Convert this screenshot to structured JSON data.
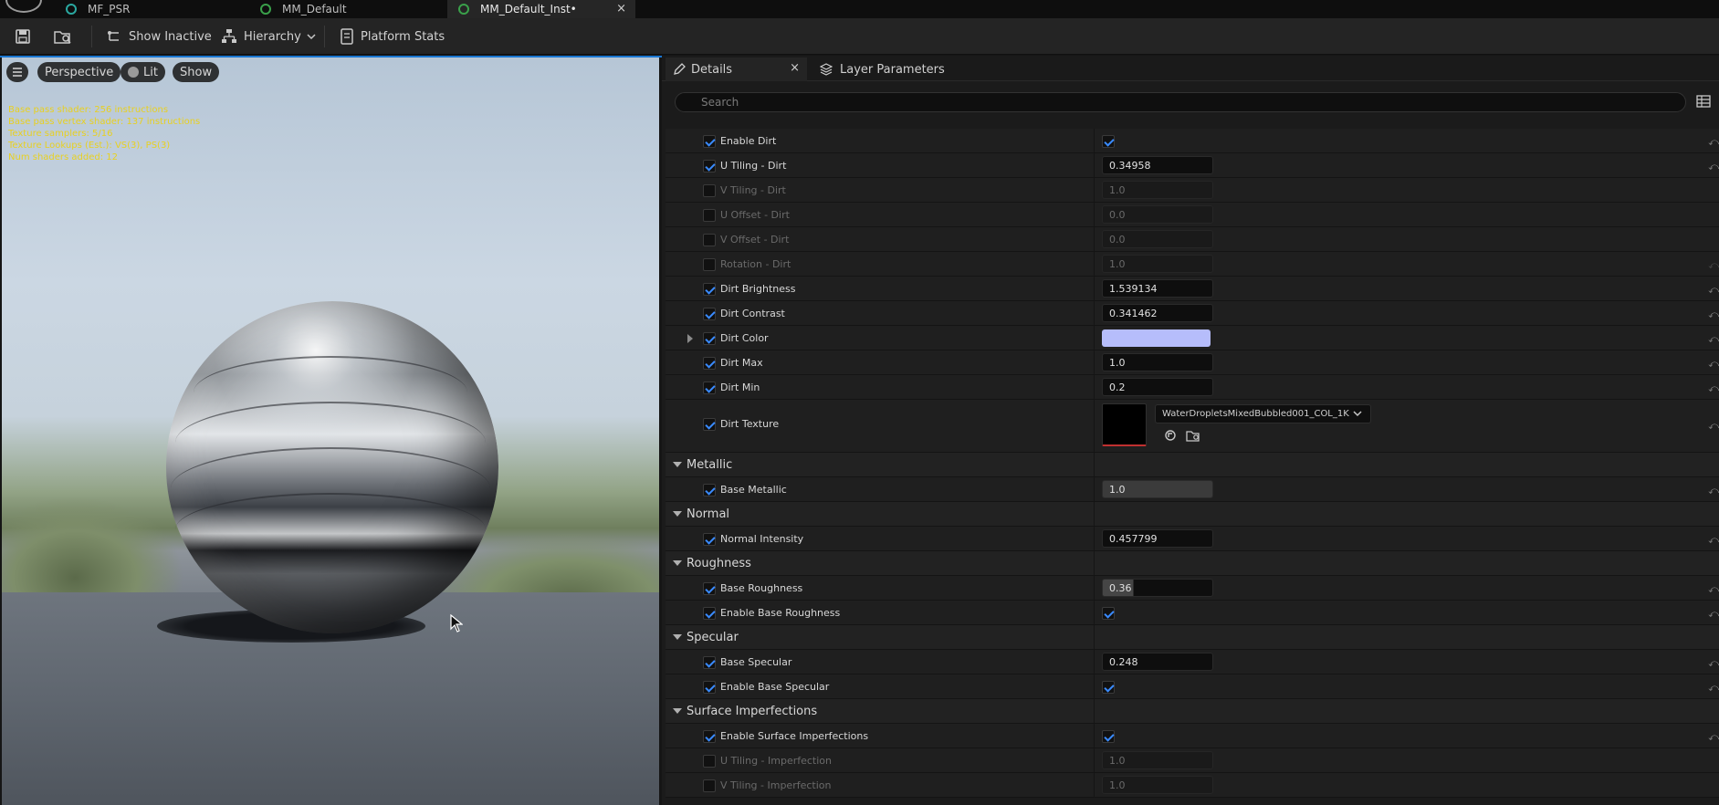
{
  "tabs": [
    {
      "label": "MF_PSR",
      "icon": "material-function-icon",
      "color": "#2aa8a0"
    },
    {
      "label": "MM_Default",
      "icon": "material-icon",
      "color": "#3aa04a"
    },
    {
      "label": "MM_Default_Inst•",
      "icon": "material-instance-icon",
      "color": "#3aa04a",
      "close": "×"
    }
  ],
  "toolbar": {
    "show_inactive": "Show Inactive",
    "hierarchy": "Hierarchy",
    "platform_stats": "Platform Stats"
  },
  "viewport": {
    "perspective": "Perspective",
    "lit": "Lit",
    "show": "Show",
    "stats": [
      "Base pass shader: 256 instructions",
      "Base pass vertex shader: 137 instructions",
      "Texture samplers: 5/16",
      "Texture Lookups (Est.): VS(3), PS(3)",
      "Num shaders added: 12"
    ]
  },
  "panel": {
    "details_tab": "Details",
    "details_close": "×",
    "layer_tab": "Layer Parameters",
    "search_placeholder": "Search",
    "dirt_texture_asset": "WaterDropletsMixedBubbled001_COL_1K",
    "rows": [
      {
        "label": "Enable Dirt",
        "checked": true,
        "value_type": "checkbox"
      },
      {
        "label": "U Tiling - Dirt",
        "checked": true,
        "value": "0.34958"
      },
      {
        "label": "V Tiling - Dirt",
        "checked": false,
        "value": "1.0"
      },
      {
        "label": "U Offset - Dirt",
        "checked": false,
        "value": "0.0"
      },
      {
        "label": "V Offset - Dirt",
        "checked": false,
        "value": "0.0"
      },
      {
        "label": "Rotation - Dirt",
        "checked": false,
        "value": "1.0"
      },
      {
        "label": "Dirt Brightness",
        "checked": true,
        "value": "1.539134"
      },
      {
        "label": "Dirt Contrast",
        "checked": true,
        "value": "0.341462"
      },
      {
        "label": "Dirt Color",
        "checked": true,
        "value_type": "color",
        "color": "#b6bdfb"
      },
      {
        "label": "Dirt Max",
        "checked": true,
        "value": "1.0"
      },
      {
        "label": "Dirt Min",
        "checked": true,
        "value": "0.2"
      },
      {
        "label": "Dirt Texture",
        "checked": true,
        "value_type": "texture"
      }
    ],
    "categories": {
      "metallic": "Metallic",
      "normal": "Normal",
      "roughness": "Roughness",
      "specular": "Specular",
      "surface": "Surface Imperfections"
    },
    "metallic_rows": [
      {
        "label": "Base Metallic",
        "value": "1.0"
      }
    ],
    "normal_rows": [
      {
        "label": "Normal Intensity",
        "value": "0.457799"
      }
    ],
    "roughness_rows": [
      {
        "label": "Base Roughness",
        "value": "0.36"
      },
      {
        "label": "Enable Base Roughness"
      }
    ],
    "specular_rows": [
      {
        "label": "Base Specular",
        "value": "0.248"
      },
      {
        "label": "Enable Base Specular"
      }
    ],
    "surface_rows": [
      {
        "label": "Enable Surface Imperfections"
      },
      {
        "label": "U Tiling - Imperfection",
        "value": "1.0"
      },
      {
        "label": "V Tiling - Imperfection",
        "value": "1.0"
      }
    ]
  }
}
